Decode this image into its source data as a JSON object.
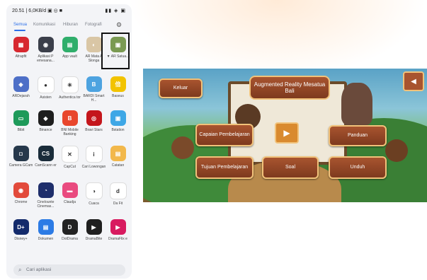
{
  "phone": {
    "status_left": "20.51 | 6,0KB/d ▣ ◎ ■",
    "status_right": "▮▮ ◈ ▣",
    "tabs": [
      {
        "label": "Semua",
        "active": true
      },
      {
        "label": "Komunikasi",
        "active": false
      },
      {
        "label": "Hiburan",
        "active": false
      },
      {
        "label": "Fotografi",
        "active": false
      }
    ],
    "settings_icon": "gear-icon",
    "apps": [
      {
        "label": "Afrapfit",
        "glyph": "▦",
        "color": "#d7282f"
      },
      {
        "label": "Aplikasi P emesana...",
        "glyph": "◉",
        "color": "#3b3f4a"
      },
      {
        "label": "App vault",
        "glyph": "▤",
        "color": "#2fae6b"
      },
      {
        "label": "AR Mata A Slonga",
        "glyph": "◐",
        "color": "#d9c6a5"
      },
      {
        "label": "▼ AR Satua...",
        "glyph": "▣",
        "color": "#7a9a52"
      },
      {
        "label": "ARDejarah",
        "glyph": "◈",
        "color": "#4d6fc7"
      },
      {
        "label": "Asisten",
        "glyph": "●",
        "color": "#ffffff"
      },
      {
        "label": "Authentica tor",
        "glyph": "✳",
        "color": "#ffffff"
      },
      {
        "label": "BARDI Smart H...",
        "glyph": "B",
        "color": "#4da3e0"
      },
      {
        "label": "Baseus",
        "glyph": "倍",
        "color": "#f2c300"
      },
      {
        "label": "Bibit",
        "glyph": "▭",
        "color": "#1e9a5a"
      },
      {
        "label": "Binance",
        "glyph": "◆",
        "color": "#1e1e1e"
      },
      {
        "label": "BNI Mobile Banking",
        "glyph": "B",
        "color": "#e8462c"
      },
      {
        "label": "Bravi Stars",
        "glyph": "◎",
        "color": "#c4161c"
      },
      {
        "label": "Bstation",
        "glyph": "▣",
        "color": "#3ea7e6"
      },
      {
        "label": "Camera GCam",
        "glyph": "◘",
        "color": "#26384b"
      },
      {
        "label": "CamScann er",
        "glyph": "CS",
        "color": "#1a2c3a"
      },
      {
        "label": "CapCut",
        "glyph": "✕",
        "color": "#ffffff"
      },
      {
        "label": "Cari Lowongan",
        "glyph": "i",
        "color": "#ffffff"
      },
      {
        "label": "Catatan",
        "glyph": "▤",
        "color": "#f2b84b"
      },
      {
        "label": "Chrome",
        "glyph": "◉",
        "color": "#e24a3b"
      },
      {
        "label": "Cinelounte Cinemas...",
        "glyph": "◔",
        "color": "#1e2e6b"
      },
      {
        "label": "Claudja",
        "glyph": "▬",
        "color": "#e94a7f"
      },
      {
        "label": "Cuaca",
        "glyph": "◑",
        "color": "#ffffff"
      },
      {
        "label": "Da Fit",
        "glyph": "d",
        "color": "#ffffff"
      },
      {
        "label": "Disney+",
        "glyph": "D+",
        "color": "#132a6b"
      },
      {
        "label": "Dokumen",
        "glyph": "▤",
        "color": "#2c7be5"
      },
      {
        "label": "DotDrama",
        "glyph": "D",
        "color": "#222222"
      },
      {
        "label": "DramaBite",
        "glyph": "▶",
        "color": "#1f1f1f"
      },
      {
        "label": "DramaFlix e",
        "glyph": "▶",
        "color": "#d81b60"
      }
    ],
    "search_placeholder": "Cari aplikasi",
    "search_icon": "search-icon"
  },
  "game": {
    "title": "Augmented Reality Mesatua Bali",
    "buttons": {
      "keluar": "Keluar",
      "capaian": "Capaian Pembelajaran",
      "tujuan": "Tujuan Pembelajaran",
      "panduan": "Panduan",
      "soal": "Soal",
      "unduh": "Unduh"
    },
    "sound_icon": "speaker-icon",
    "play_icon": "play-icon"
  }
}
